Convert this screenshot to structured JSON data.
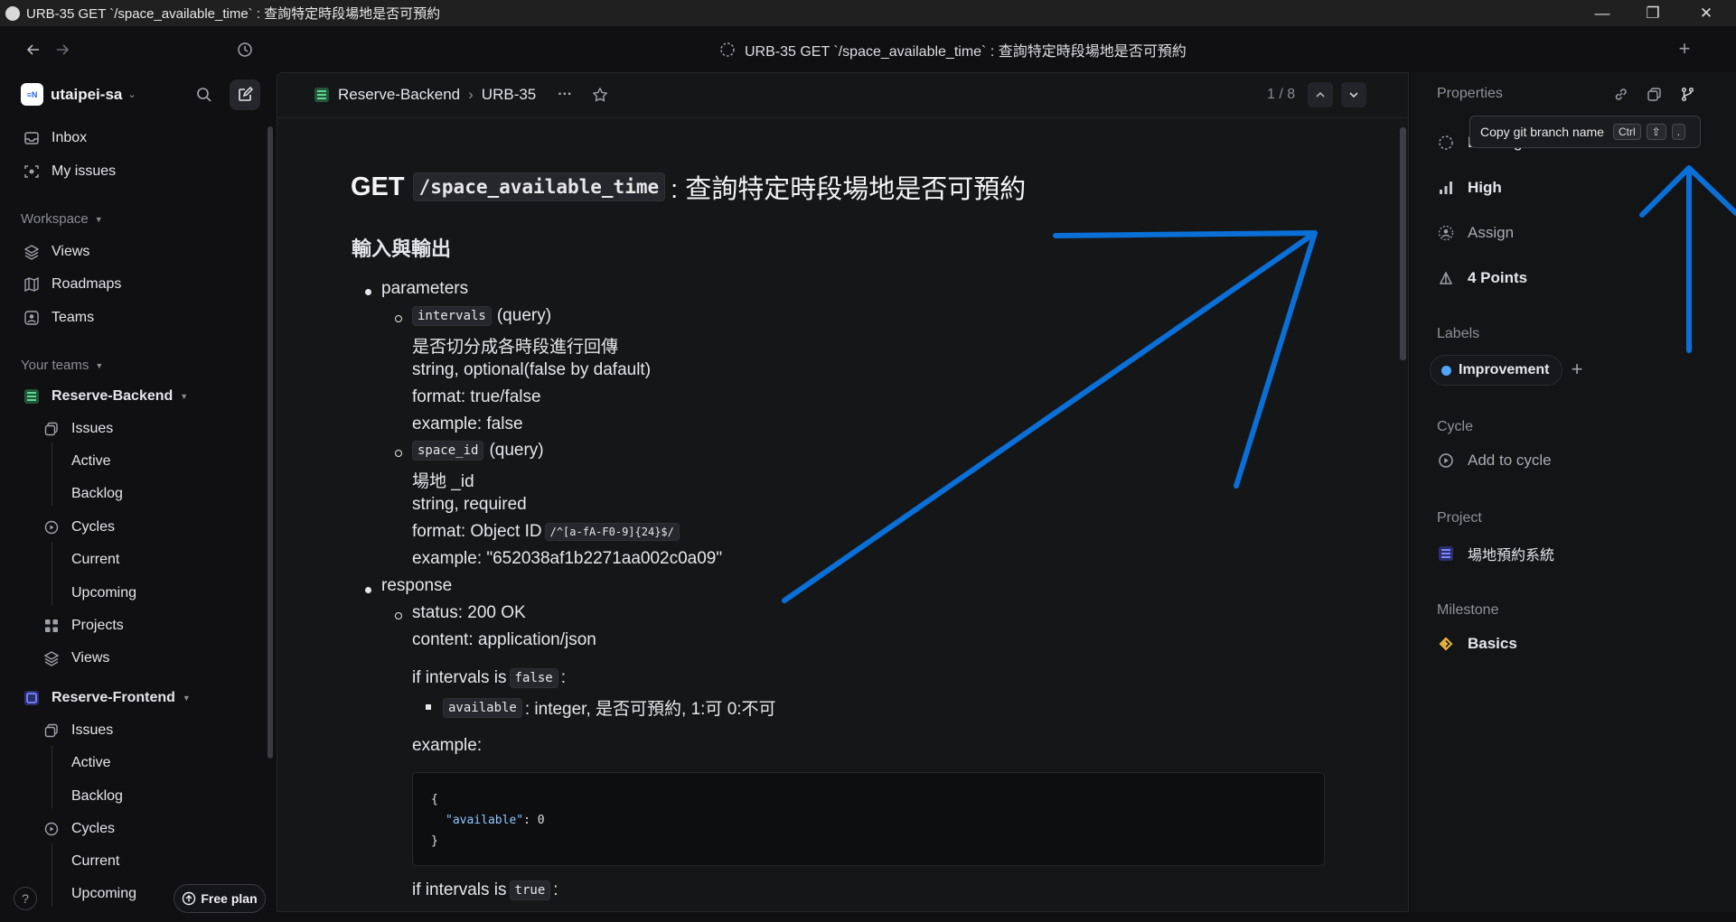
{
  "window": {
    "title": "URB-35 GET `/space_available_time` : 查詢特定時段場地是否可預約",
    "minimize": "—",
    "maximize": "❐",
    "close": "✕"
  },
  "topbar": {
    "tab_title": "URB-35 GET `/space_available_time` : 查詢特定時段場地是否可預約",
    "plus": "+"
  },
  "sidebar": {
    "workspace_name": "utaipei-sa",
    "workspace_logo": "≡N",
    "nav": [
      {
        "label": "Inbox",
        "icon": "inbox-icon"
      },
      {
        "label": "My issues",
        "icon": "my-issues-icon"
      }
    ],
    "workspace_section": "Workspace",
    "workspace_items": [
      {
        "label": "Views",
        "icon": "layers-icon"
      },
      {
        "label": "Roadmaps",
        "icon": "map-icon"
      },
      {
        "label": "Teams",
        "icon": "teams-icon"
      }
    ],
    "teams_section": "Your teams",
    "team1": {
      "name": "Reserve-Backend",
      "issues": "Issues",
      "active": "Active",
      "backlog": "Backlog",
      "cycles": "Cycles",
      "current": "Current",
      "upcoming": "Upcoming",
      "projects": "Projects",
      "views": "Views"
    },
    "team2": {
      "name": "Reserve-Frontend",
      "issues": "Issues",
      "active": "Active",
      "backlog": "Backlog",
      "cycles": "Cycles",
      "current": "Current",
      "upcoming": "Upcoming"
    },
    "help": "?",
    "free_plan": "Free plan"
  },
  "breadcrumb": {
    "team": "Reserve-Backend",
    "sep": "›",
    "issue": "URB-35",
    "more": "···",
    "pager": "1 / 8"
  },
  "issue": {
    "title_method": "GET",
    "title_path": "/space_available_time",
    "title_rest": ": 查詢特定時段場地是否可預約",
    "h2": "輸入與輸出",
    "parameters": "parameters",
    "p1_code": "intervals",
    "p1_kind": "(query)",
    "p1_desc": "是否切分成各時段進行回傳",
    "p1_type": "string, optional(false by dafault)",
    "p1_format": "format: true/false",
    "p1_example": "example: false",
    "p2_code": "space_id",
    "p2_kind": "(query)",
    "p2_desc": "場地 _id",
    "p2_type": "string, required",
    "p2_format": "format: Object ID",
    "p2_regex": "/^[a-fA-F0-9]{24}$/",
    "p2_example": "example: \"652038af1b2271aa002c0a09\"",
    "response": "response",
    "status": "status: 200 OK",
    "content": "content: application/json",
    "if_false_pre": "if intervals is",
    "if_false_code": "false",
    "if_false_post": ":",
    "avail_code": "available",
    "avail_desc": ": integer, 是否可預約, 1:可 0:不可",
    "example": "example:",
    "code_line1": "{",
    "code_key": "\"available\"",
    "code_val": ": 0",
    "code_line3": "}",
    "if_true_pre": "if intervals is",
    "if_true_code": "true",
    "if_true_post": ":"
  },
  "properties": {
    "title": "Properties",
    "status": "Backlog",
    "priority": "High",
    "assignee": "Assign",
    "estimate": "4 Points",
    "labels_title": "Labels",
    "label": "Improvement",
    "label_color": "#4ea7fc",
    "cycle_title": "Cycle",
    "cycle": "Add to cycle",
    "project_title": "Project",
    "project": "場地預約系統",
    "milestone_title": "Milestone",
    "milestone": "Basics"
  },
  "tooltip": {
    "text": "Copy git branch name",
    "key1": "Ctrl",
    "key2": "⇧",
    "key3": "."
  },
  "colors": {
    "annotation_arrow": "#0a6fd6",
    "accent": "#5e6ad2",
    "backend_team": "#3aa66b",
    "frontend_team": "#5b67e8",
    "milestone": "#e3b341"
  }
}
